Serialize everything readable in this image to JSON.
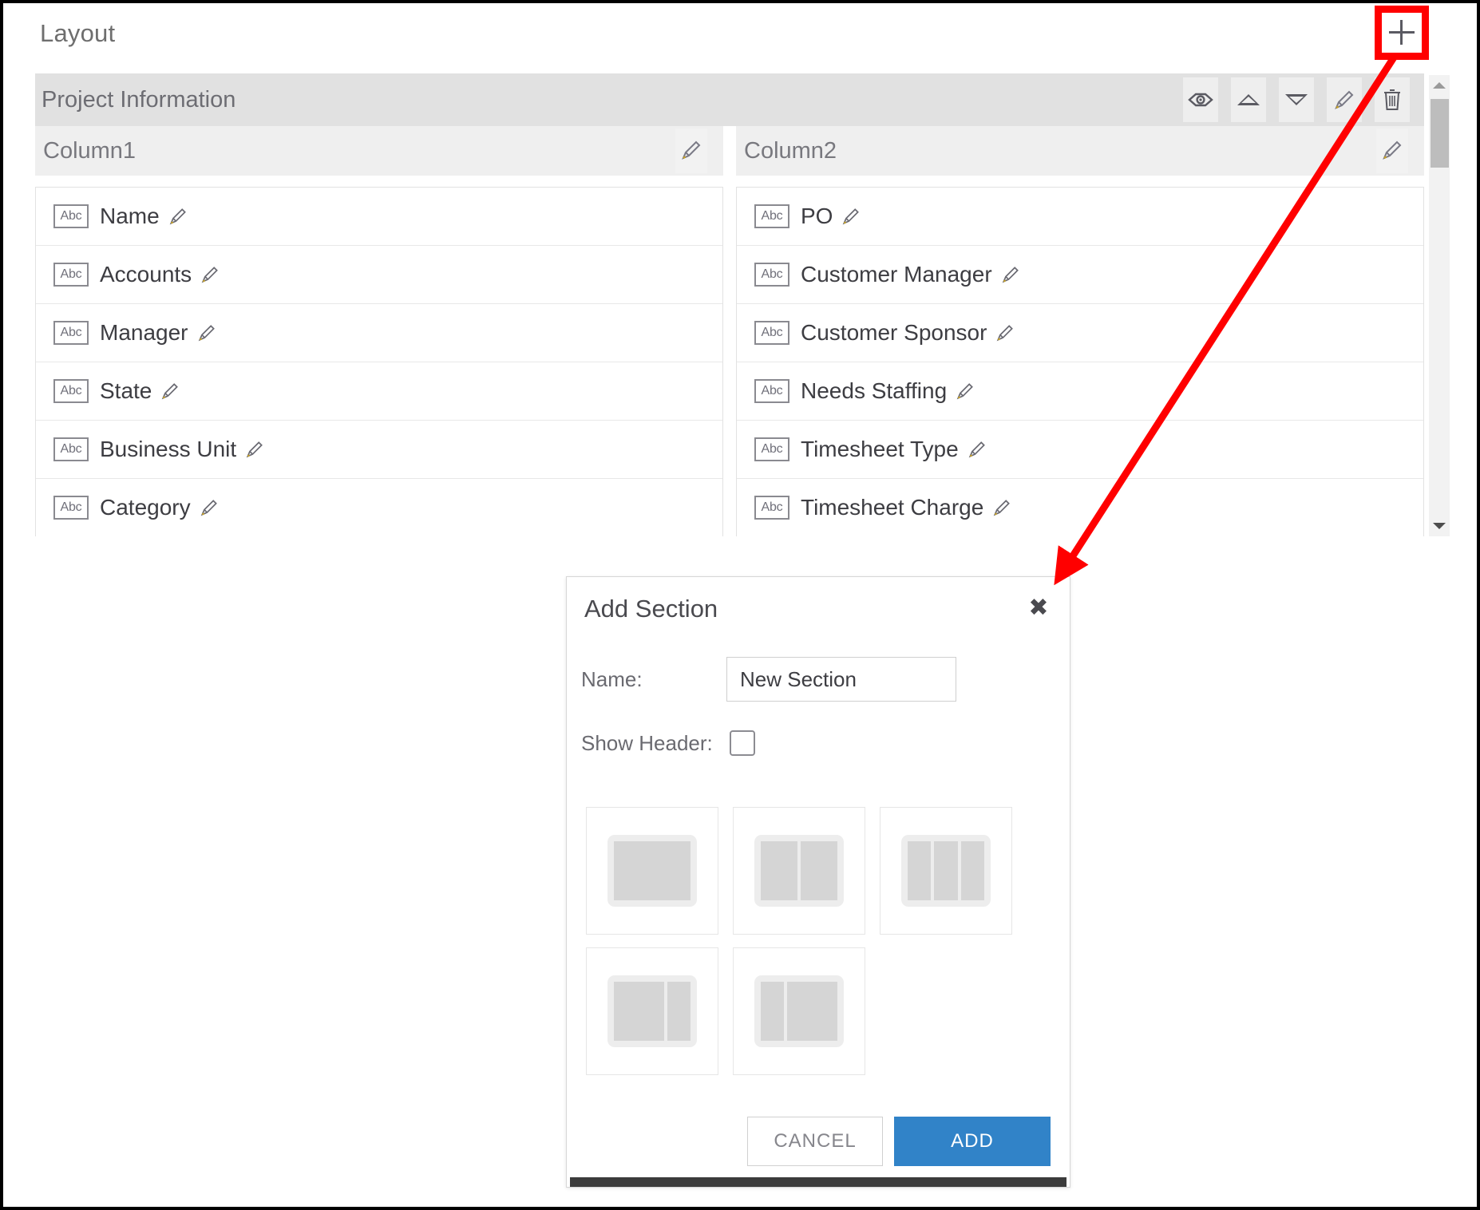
{
  "page": {
    "caption": "Layout"
  },
  "toolbar": {
    "add_section_icon": "plus-icon",
    "add_section_tooltip": "Add Section"
  },
  "section": {
    "title": "Project Information",
    "tools": [
      {
        "name": "preview-icon",
        "label": "Preview"
      },
      {
        "name": "move-up-icon",
        "label": "Move Up"
      },
      {
        "name": "move-down-icon",
        "label": "Move Down"
      },
      {
        "name": "edit-icon",
        "label": "Edit"
      },
      {
        "name": "delete-icon",
        "label": "Delete"
      }
    ],
    "columns": [
      {
        "title": "Column1",
        "edit_icon": "pencil-icon",
        "fields": [
          {
            "type_badge": "Abc",
            "label": "Name"
          },
          {
            "type_badge": "Abc",
            "label": "Accounts"
          },
          {
            "type_badge": "Abc",
            "label": "Manager"
          },
          {
            "type_badge": "Abc",
            "label": "State"
          },
          {
            "type_badge": "Abc",
            "label": "Business Unit"
          },
          {
            "type_badge": "Abc",
            "label": "Category"
          }
        ]
      },
      {
        "title": "Column2",
        "edit_icon": "pencil-icon",
        "fields": [
          {
            "type_badge": "Abc",
            "label": "PO"
          },
          {
            "type_badge": "Abc",
            "label": "Customer Manager"
          },
          {
            "type_badge": "Abc",
            "label": "Customer Sponsor"
          },
          {
            "type_badge": "Abc",
            "label": "Needs Staffing"
          },
          {
            "type_badge": "Abc",
            "label": "Timesheet Type"
          },
          {
            "type_badge": "Abc",
            "label": "Timesheet Charge"
          }
        ]
      }
    ]
  },
  "scrollbar": {
    "up_icon": "scroll-up-icon",
    "down_icon": "scroll-down-icon"
  },
  "dialog": {
    "title": "Add Section",
    "close_icon": "close-icon",
    "name_label": "Name:",
    "name_value": "New Section",
    "name_placeholder": "New Section",
    "show_header_label": "Show Header:",
    "show_header_checked": false,
    "layout_options": [
      {
        "name": "layout-one-column",
        "panes": [
          1
        ]
      },
      {
        "name": "layout-two-equal-columns",
        "panes": [
          1,
          1
        ]
      },
      {
        "name": "layout-three-columns",
        "panes": [
          1,
          1,
          1
        ]
      },
      {
        "name": "layout-wide-left-narrow-right",
        "panes": [
          2.2,
          1
        ]
      },
      {
        "name": "layout-narrow-left-wide-right",
        "panes": [
          1,
          2.2
        ]
      }
    ],
    "cancel_label": "CANCEL",
    "add_label": "ADD"
  },
  "annotation": {
    "highlight_color": "#ff0000",
    "arrow_from": "add-section-button",
    "arrow_to": "add-section-dialog"
  },
  "colors": {
    "accent_blue": "#3183c8",
    "section_header_bg": "#e1e1e1",
    "column_header_bg": "#efefef",
    "annotation_red": "#ff0000",
    "text_dark": "#3d3d42",
    "text_muted": "#6d6d73"
  }
}
